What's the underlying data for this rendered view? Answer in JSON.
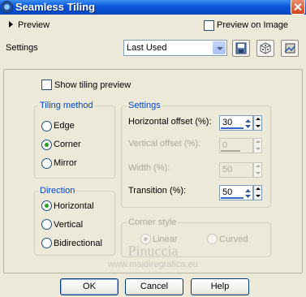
{
  "window": {
    "title": "Seamless Tiling"
  },
  "preview": {
    "label": "Preview",
    "preview_on_image_label": "Preview on Image"
  },
  "settings": {
    "label": "Settings",
    "preset_value": "Last Used"
  },
  "show_tiling_preview_label": "Show tiling preview",
  "tiling_method": {
    "legend": "Tiling method",
    "options": [
      "Edge",
      "Corner",
      "Mirror"
    ],
    "selected": "Corner"
  },
  "settings_group": {
    "legend": "Settings",
    "horizontal_offset": {
      "label": "Horizontal offset (%):",
      "value": "30"
    },
    "vertical_offset": {
      "label": "Vertical offset (%):",
      "value": "0"
    },
    "width": {
      "label": "Width (%):",
      "value": "50"
    },
    "transition": {
      "label": "Transition (%):",
      "value": "50"
    }
  },
  "direction": {
    "legend": "Direction",
    "options": [
      "Horizontal",
      "Vertical",
      "Bidirectional"
    ],
    "selected": "Horizontal"
  },
  "corner_style": {
    "legend": "Corner style",
    "options": [
      "Linear",
      "Curved"
    ],
    "selected": "Linear"
  },
  "watermark": {
    "name": "Pinuccia",
    "url": "www.maidiregrafica.eu"
  },
  "buttons": {
    "ok": "OK",
    "cancel": "Cancel",
    "help": "Help"
  },
  "colors": {
    "titlebar": "#0a55d9",
    "dialog_bg": "#ece9d8",
    "legend_text": "#0046d5",
    "radio_dot": "#21a121"
  },
  "icons": [
    "save-preset-icon",
    "randomize-icon",
    "reset-icon"
  ]
}
